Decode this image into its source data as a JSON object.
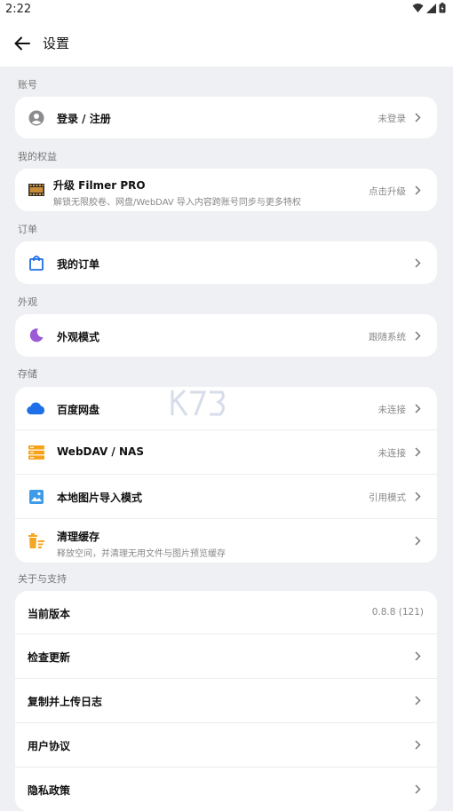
{
  "status_bar": {
    "time": "2:22"
  },
  "header": {
    "title": "设置"
  },
  "sections": {
    "account": {
      "label": "账号",
      "items": [
        {
          "label": "登录 / 注册",
          "value": "未登录"
        }
      ]
    },
    "benefits": {
      "label": "我的权益",
      "items": [
        {
          "label": "升级 Filmer PRO",
          "sub": "解锁无限胶卷、网盘/WebDAV 导入内容跨账号同步与更多特权",
          "value": "点击升级"
        }
      ]
    },
    "orders": {
      "label": "订单",
      "items": [
        {
          "label": "我的订单"
        }
      ]
    },
    "appearance": {
      "label": "外观",
      "items": [
        {
          "label": "外观模式",
          "value": "跟随系统"
        }
      ]
    },
    "storage": {
      "label": "存储",
      "items": [
        {
          "label": "百度网盘",
          "value": "未连接"
        },
        {
          "label": "WebDAV / NAS",
          "value": "未连接"
        },
        {
          "label": "本地图片导入模式",
          "value": "引用模式"
        },
        {
          "label": "清理缓存",
          "sub": "释放空间，并清理无用文件与图片预览缓存"
        }
      ]
    },
    "about": {
      "label": "关于与支持",
      "items": [
        {
          "label": "当前版本",
          "value": "0.8.8 (121)"
        },
        {
          "label": "检查更新"
        },
        {
          "label": "复制并上传日志"
        },
        {
          "label": "用户协议"
        },
        {
          "label": "隐私政策"
        }
      ]
    }
  },
  "colors": {
    "cloud_blue": "#1e6fe8",
    "webdav_orange": "#f7a21b",
    "image_blue": "#3d9be9",
    "cache_orange": "#f5a623",
    "moon_purple": "#9b5ad6",
    "bag_blue": "#1e6fe8"
  }
}
